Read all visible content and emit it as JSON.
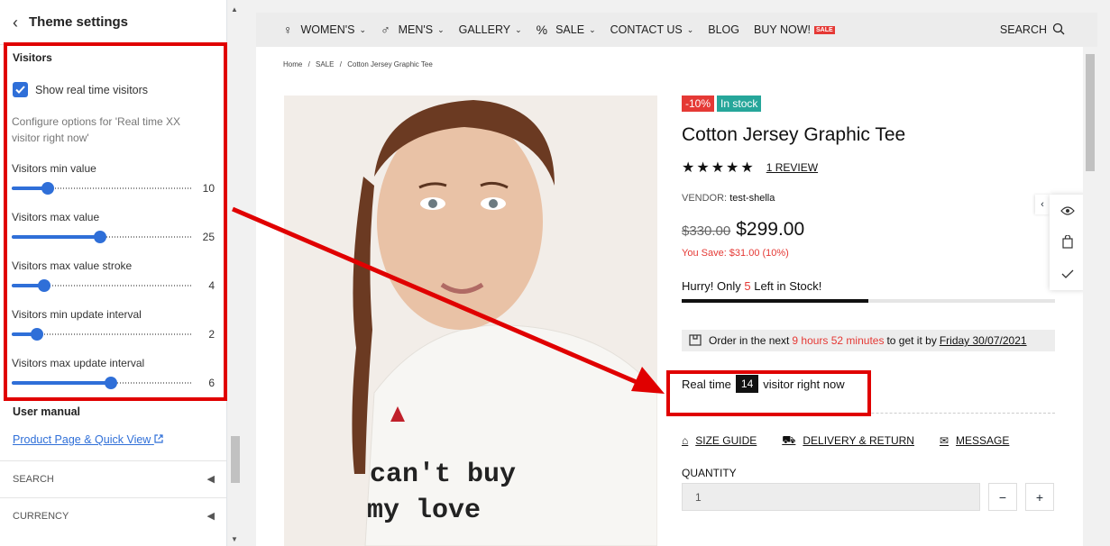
{
  "sidebar": {
    "title": "Theme settings",
    "section_title": "Visitors",
    "checkbox_label": "Show real time visitors",
    "hint": "Configure options for 'Real time XX visitor right now'",
    "sliders": [
      {
        "label": "Visitors min value",
        "value": "10",
        "fraction": 0.2
      },
      {
        "label": "Visitors max value",
        "value": "25",
        "fraction": 0.49
      },
      {
        "label": "Visitors max value stroke",
        "value": "4",
        "fraction": 0.18
      },
      {
        "label": "Visitors min update interval",
        "value": "2",
        "fraction": 0.14
      },
      {
        "label": "Visitors max update interval",
        "value": "6",
        "fraction": 0.55
      }
    ],
    "user_manual_title": "User manual",
    "user_manual_link": "Product Page & Quick View",
    "search_label": "SEARCH",
    "currency_label": "CURRENCY"
  },
  "nav": {
    "items": [
      {
        "label": "WOMEN'S",
        "icon": "woman-icon",
        "chevron": true
      },
      {
        "label": "MEN'S",
        "icon": "man-icon",
        "chevron": true
      },
      {
        "label": "GALLERY",
        "chevron": true
      },
      {
        "label": "SALE",
        "icon": "percent-icon",
        "chevron": true
      },
      {
        "label": "CONTACT US",
        "chevron": true
      },
      {
        "label": "BLOG",
        "chevron": false
      },
      {
        "label": "BUY NOW!",
        "badge": "SALE",
        "chevron": false
      }
    ],
    "search_label": "SEARCH"
  },
  "breadcrumb": {
    "home": "Home",
    "sep": "/",
    "sale": "SALE",
    "current": "Cotton Jersey Graphic Tee"
  },
  "product": {
    "discount_badge": "-10%",
    "stock_badge": "In stock",
    "title": "Cotton Jersey Graphic Tee",
    "stars": "★★★★★",
    "review_link": "1 REVIEW",
    "vendor_label": "VENDOR:",
    "vendor_name": "test-shella",
    "old_price": "$330.00",
    "new_price": "$299.00",
    "you_save": "You Save: $31.00 (10%)",
    "hurry_pre": "Hurry! Only",
    "hurry_num": "5",
    "hurry_post": "Left in Stock!",
    "stock_fraction": 0.5,
    "order_pre": "Order in the next",
    "order_time": "9 hours 52 minutes",
    "order_mid": "to get it by",
    "order_date": "Friday 30/07/2021",
    "rt_pre": "Real time",
    "rt_count": "14",
    "rt_post": "visitor right now",
    "size_guide": "SIZE GUIDE",
    "delivery": "DELIVERY & RETURN",
    "message": "MESSAGE",
    "quantity_label": "QUANTITY",
    "quantity_value": "1",
    "minus": "−",
    "plus": "+",
    "shirt_text_line1": "can't buy",
    "shirt_text_line2": "my love"
  },
  "colors": {
    "accent": "#2f6fd8",
    "highlight": "#e00000",
    "sale": "#e53935",
    "in_stock": "#26a69a"
  }
}
